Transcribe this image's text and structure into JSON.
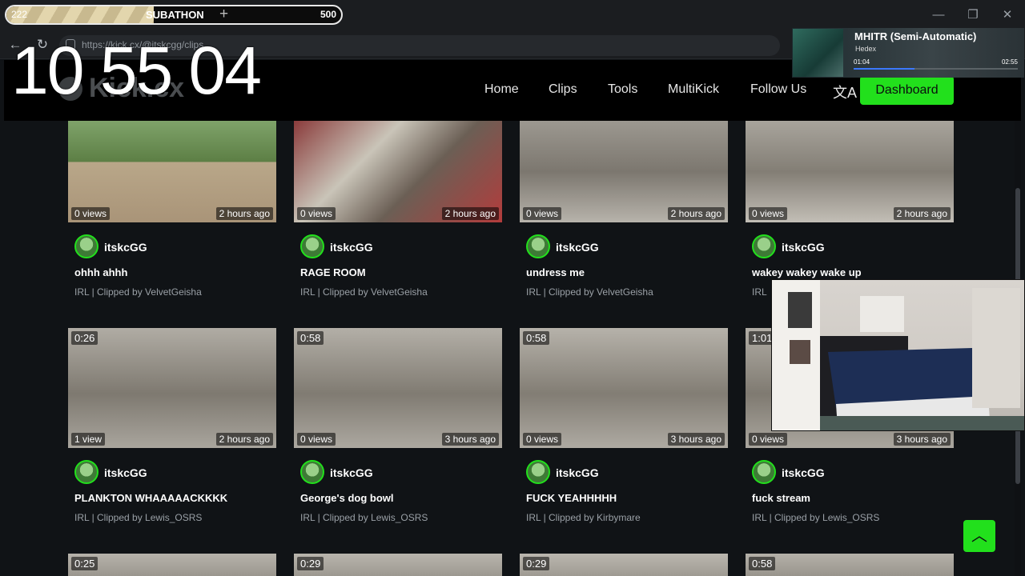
{
  "browser": {
    "url": "https://kick.cx/@itskcgg/clips",
    "window_controls": [
      "—",
      "❐",
      "✕"
    ]
  },
  "site": {
    "logo": "Kick.cx",
    "nav": [
      "Home",
      "Clips",
      "Tools",
      "MultiKick",
      "Follow Us"
    ],
    "dashboard_label": "Dashboard"
  },
  "subathon": {
    "left_value": "222",
    "title": "SUBATHON",
    "right_value": "500",
    "progress_fraction": 0.44
  },
  "clock": "10 55 04",
  "now_playing": {
    "song": "MHITR (Semi-Automatic)",
    "artist": "Hedex",
    "elapsed": "01:04",
    "duration": "02:55",
    "progress_fraction": 0.37
  },
  "clips": [
    {
      "duration": "",
      "views": "0 views",
      "ago": "2 hours ago",
      "channel": "itskcGG",
      "title": "ohhh ahhh",
      "meta": "IRL | Clipped by VelvetGeisha"
    },
    {
      "duration": "",
      "views": "0 views",
      "ago": "2 hours ago",
      "channel": "itskcGG",
      "title": "RAGE ROOM",
      "meta": "IRL | Clipped by VelvetGeisha"
    },
    {
      "duration": "",
      "views": "0 views",
      "ago": "2 hours ago",
      "channel": "itskcGG",
      "title": "undress me",
      "meta": "IRL | Clipped by VelvetGeisha"
    },
    {
      "duration": "",
      "views": "0 views",
      "ago": "2 hours ago",
      "channel": "itskcGG",
      "title": "wakey wakey wake up",
      "meta": "IRL"
    },
    {
      "duration": "0:26",
      "views": "1 view",
      "ago": "2 hours ago",
      "channel": "itskcGG",
      "title": "PLANKTON WHAAAAACKKKK",
      "meta": "IRL | Clipped by Lewis_OSRS"
    },
    {
      "duration": "0:58",
      "views": "0 views",
      "ago": "3 hours ago",
      "channel": "itskcGG",
      "title": "George's dog bowl",
      "meta": "IRL | Clipped by Lewis_OSRS"
    },
    {
      "duration": "0:58",
      "views": "0 views",
      "ago": "3 hours ago",
      "channel": "itskcGG",
      "title": "FUCK YEAHHHHH",
      "meta": "IRL | Clipped by Kirbymare"
    },
    {
      "duration": "1:01",
      "views": "0 views",
      "ago": "3 hours ago",
      "channel": "itskcGG",
      "title": "fuck stream",
      "meta": "IRL | Clipped by Lewis_OSRS"
    },
    {
      "duration": "0:25"
    },
    {
      "duration": "0:29"
    },
    {
      "duration": "0:29"
    },
    {
      "duration": "0:58"
    }
  ]
}
